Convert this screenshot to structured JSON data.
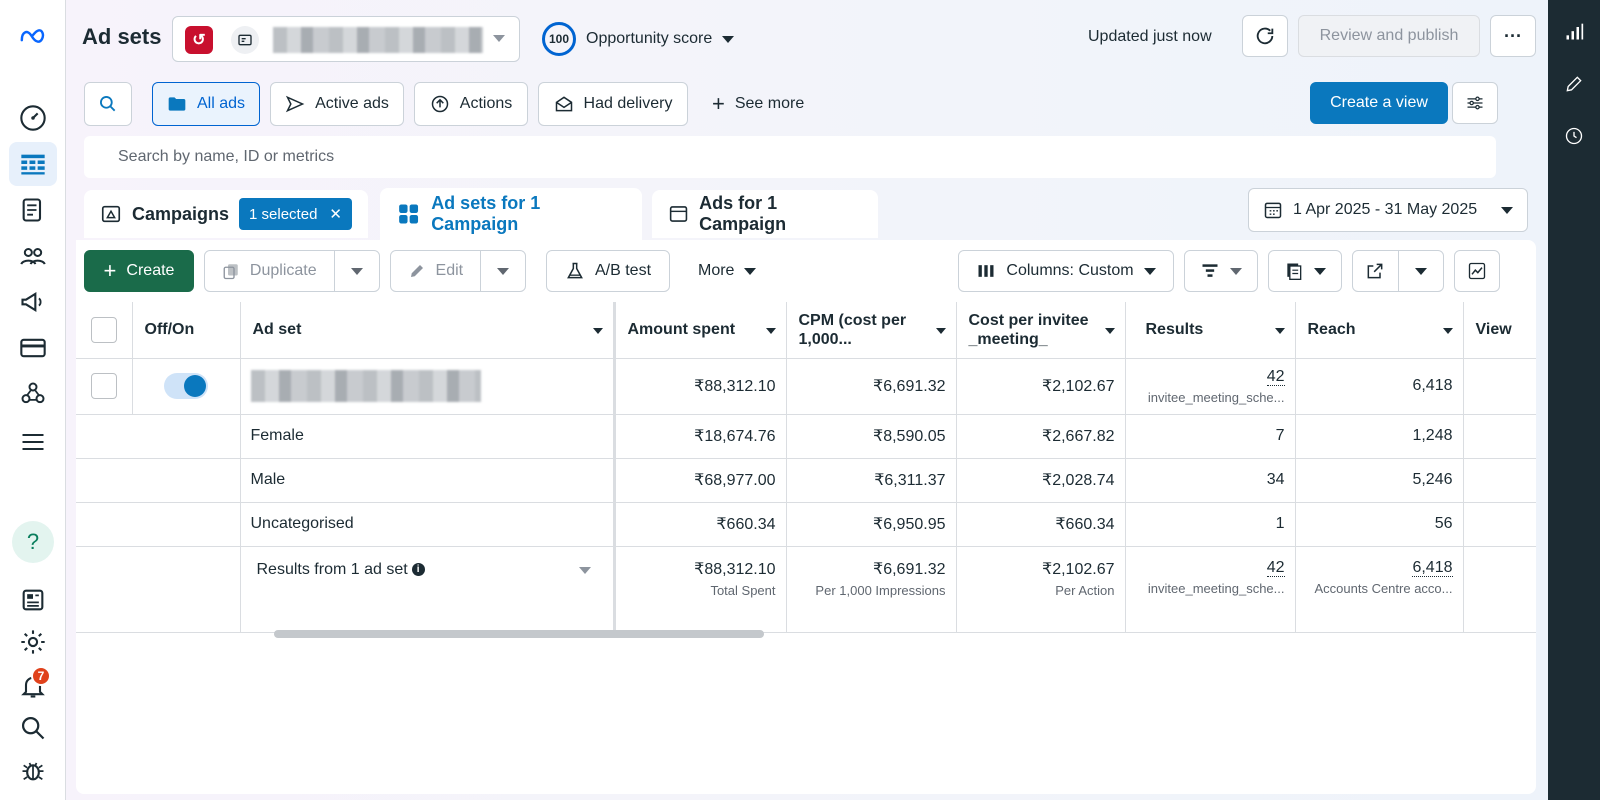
{
  "topbar": {
    "title": "Ad sets",
    "opportunity_score": "100",
    "opportunity_label": "Opportunity score",
    "updated": "Updated just now",
    "review_publish": "Review and publish",
    "more": "···"
  },
  "filters": {
    "all_ads": "All ads",
    "active_ads": "Active ads",
    "actions": "Actions",
    "had_delivery": "Had delivery",
    "see_more": "See more",
    "create_view": "Create a view"
  },
  "search": {
    "placeholder": "Search by name, ID or metrics"
  },
  "tabs": {
    "campaigns": "Campaigns",
    "selected_chip": "1 selected",
    "adsets": "Ad sets for 1 Campaign",
    "ads": "Ads for 1 Campaign"
  },
  "date_range": "1 Apr 2025 - 31 May 2025",
  "toolbar": {
    "create": "Create",
    "duplicate": "Duplicate",
    "edit": "Edit",
    "ab_test": "A/B test",
    "more": "More",
    "columns": "Columns: Custom"
  },
  "table": {
    "headers": {
      "offon": "Off/On",
      "adset": "Ad set",
      "amount": "Amount spent",
      "cpm": "CPM (cost per 1,000...",
      "cost": "Cost per invitee_meeting_",
      "results": "Results",
      "reach": "Reach",
      "views": "View"
    },
    "main_row": {
      "amount": "₹88,312.10",
      "cpm": "₹6,691.32",
      "cost": "₹2,102.67",
      "results": "42",
      "results_sub": "invitee_meeting_sche...",
      "reach": "6,418"
    },
    "breakdown": [
      {
        "name": "Female",
        "amount": "₹18,674.76",
        "cpm": "₹8,590.05",
        "cost": "₹2,667.82",
        "results": "7",
        "reach": "1,248"
      },
      {
        "name": "Male",
        "amount": "₹68,977.00",
        "cpm": "₹6,311.37",
        "cost": "₹2,028.74",
        "results": "34",
        "reach": "5,246"
      },
      {
        "name": "Uncategorised",
        "amount": "₹660.34",
        "cpm": "₹6,950.95",
        "cost": "₹660.34",
        "results": "1",
        "reach": "56"
      }
    ],
    "summary": {
      "label": "Results from 1 ad set",
      "amount": "₹88,312.10",
      "amount_sub": "Total Spent",
      "cpm": "₹6,691.32",
      "cpm_sub": "Per 1,000 Impressions",
      "cost": "₹2,102.67",
      "cost_sub": "Per Action",
      "results": "42",
      "results_sub": "invitee_meeting_sche...",
      "reach": "6,418",
      "reach_sub": "Accounts Centre acco..."
    }
  },
  "nav": {
    "notifications_count": "7"
  },
  "colors": {
    "accent": "#0a78be",
    "create_green": "#1a6b4a",
    "badge": "#e0421c"
  }
}
